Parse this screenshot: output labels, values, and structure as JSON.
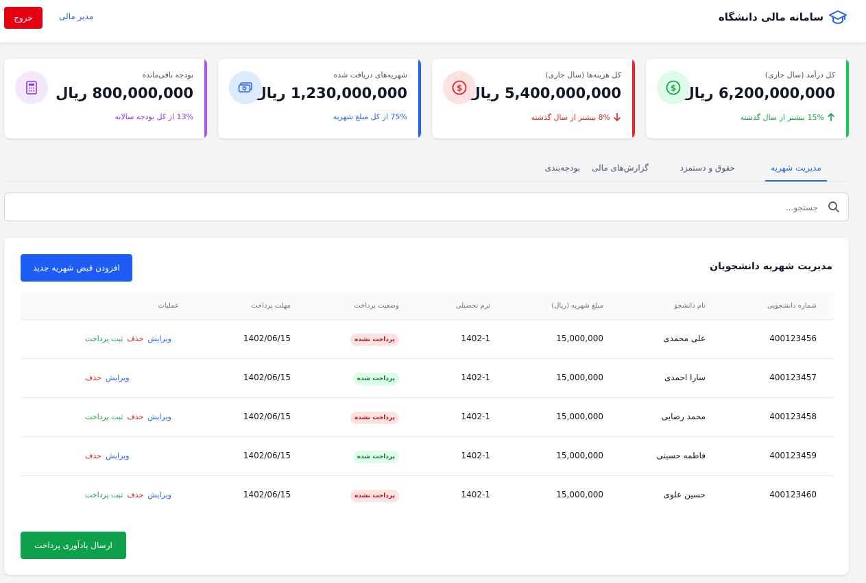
{
  "header": {
    "title": "سامانه مالی دانشگاه",
    "user_role": "مدیر مالی",
    "logout_label": "خروج"
  },
  "stats": [
    {
      "label": "کل درآمد (سال جاری)",
      "value": "6,200,000,000 ریال",
      "sub": "15% بیشتر از سال گذشته",
      "accent": "#16c45a",
      "icon": "dollar-icon"
    },
    {
      "label": "کل هزینه‌ها (سال جاری)",
      "value": "5,400,000,000 ریال",
      "sub": "8% بیشتر از سال گذشته",
      "accent": "#e5282e",
      "icon": "dollar-icon"
    },
    {
      "label": "شهریه‌های دریافت شده",
      "value": "1,230,000,000 ریال",
      "sub": "75% از کل مبلغ شهریه",
      "accent": "#2563eb",
      "icon": "cash-icon"
    },
    {
      "label": "بودجه باقی‌مانده",
      "value": "800,000,000 ریال",
      "sub": "13% از کل بودجه سالانه",
      "accent": "#a855f7",
      "icon": "calculator-icon"
    }
  ],
  "tabs": [
    {
      "label": "مدیریت شهریه",
      "active": true
    },
    {
      "label": "حقوق و دستمزد",
      "active": false
    },
    {
      "label": "گزارش‌های مالی",
      "active": false
    },
    {
      "label": "بودجه‌بندی",
      "active": false
    }
  ],
  "search": {
    "placeholder": "جستجو...",
    "value": ""
  },
  "panel": {
    "title": "مدیریت شهریه دانشجویان",
    "add_label": "افزودن قبض شهریه جدید",
    "remind_label": "ارسال یادآوری پرداخت"
  },
  "table": {
    "columns": [
      "شماره دانشجویی",
      "نام دانشجو",
      "مبلغ شهریه (ریال)",
      "ترم تحصیلی",
      "وضعیت پرداخت",
      "مهلت پرداخت",
      "عملیات"
    ],
    "rows": [
      {
        "id": "400123456",
        "name": "علی محمدی",
        "amount": "15,000,000",
        "term": "1402-1",
        "status": "پرداخت نشده",
        "paid": false,
        "deadline": "1402/06/15"
      },
      {
        "id": "400123457",
        "name": "سارا احمدی",
        "amount": "15,000,000",
        "term": "1402-1",
        "status": "پرداخت شده",
        "paid": true,
        "deadline": "1402/06/15"
      },
      {
        "id": "400123458",
        "name": "محمد رضایی",
        "amount": "15,000,000",
        "term": "1402-1",
        "status": "پرداخت نشده",
        "paid": false,
        "deadline": "1402/06/15"
      },
      {
        "id": "400123459",
        "name": "فاطمه حسینی",
        "amount": "15,000,000",
        "term": "1402-1",
        "status": "پرداخت شده",
        "paid": true,
        "deadline": "1402/06/15"
      },
      {
        "id": "400123460",
        "name": "حسین علوی",
        "amount": "15,000,000",
        "term": "1402-1",
        "status": "پرداخت نشده",
        "paid": false,
        "deadline": "1402/06/15"
      }
    ],
    "actions": {
      "edit": "ویرایش",
      "delete": "حذف",
      "pay": "ثبت پرداخت"
    }
  },
  "colors": {
    "primary": "#1d5cf5",
    "success": "#0ea04a",
    "danger": "#e60012"
  }
}
